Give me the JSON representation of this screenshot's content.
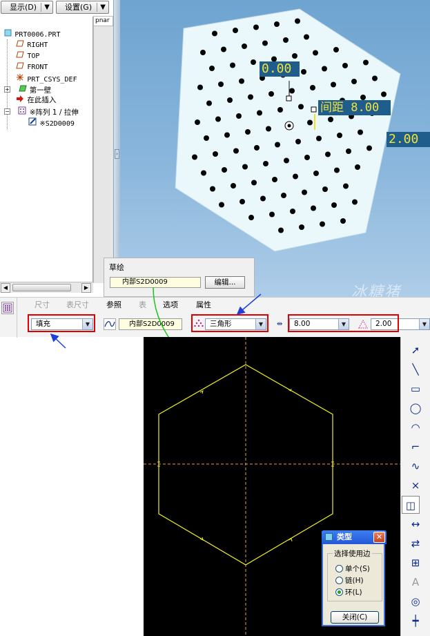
{
  "toolbar": {
    "display_label": "显示(D)",
    "settings_label": "设置(G)"
  },
  "tree_header_cut": "pnar",
  "tree": {
    "items": [
      {
        "label": "PRT0006.PRT",
        "icon": "part-icon"
      },
      {
        "label": "RIGHT",
        "icon": "datum-plane-icon"
      },
      {
        "label": "TOP",
        "icon": "datum-plane-icon"
      },
      {
        "label": "FRONT",
        "icon": "datum-plane-icon"
      },
      {
        "label": "PRT_CSYS_DEF",
        "icon": "csys-icon"
      },
      {
        "label": "第一壁",
        "icon": "extrude-icon"
      },
      {
        "label": "在此插入",
        "icon": "insert-here-arrow-icon"
      },
      {
        "label": "※阵列 1 / 拉伸",
        "icon": "pattern-icon"
      },
      {
        "label": "※S2D0009",
        "icon": "sketch-icon"
      }
    ]
  },
  "viewport": {
    "dim_value_1": "0.00",
    "dim_spacing": "间距 8.00",
    "dim_value_2": "2.00",
    "watermark": "冰糖猪"
  },
  "sketch_popup": {
    "title": "草绘",
    "field_value": "内部S2D0009",
    "edit_button": "编辑..."
  },
  "dashboard": {
    "tabs": [
      "尺寸",
      "表尺寸",
      "参照",
      "表",
      "选项",
      "属性"
    ],
    "type_combo": "填充",
    "sketch_field": "内部S2D0009",
    "pattern_combo": "三角形",
    "spacing_combo": "8.00",
    "border_combo": "2.00"
  },
  "dialog": {
    "title": "类型",
    "group_title": "选择使用边",
    "options": [
      "单个(S)",
      "链(H)",
      "环(L)"
    ],
    "selected": "环(L)",
    "close_button": "关闭(C)"
  },
  "colors": {
    "annotation_red": "#e00000",
    "annotation_blue": "#1f3fd8",
    "annotation_green": "#17c417",
    "sketch_line": "#f0f020",
    "axis_line": "#e8a040",
    "part_face": "#eaf8fc"
  }
}
